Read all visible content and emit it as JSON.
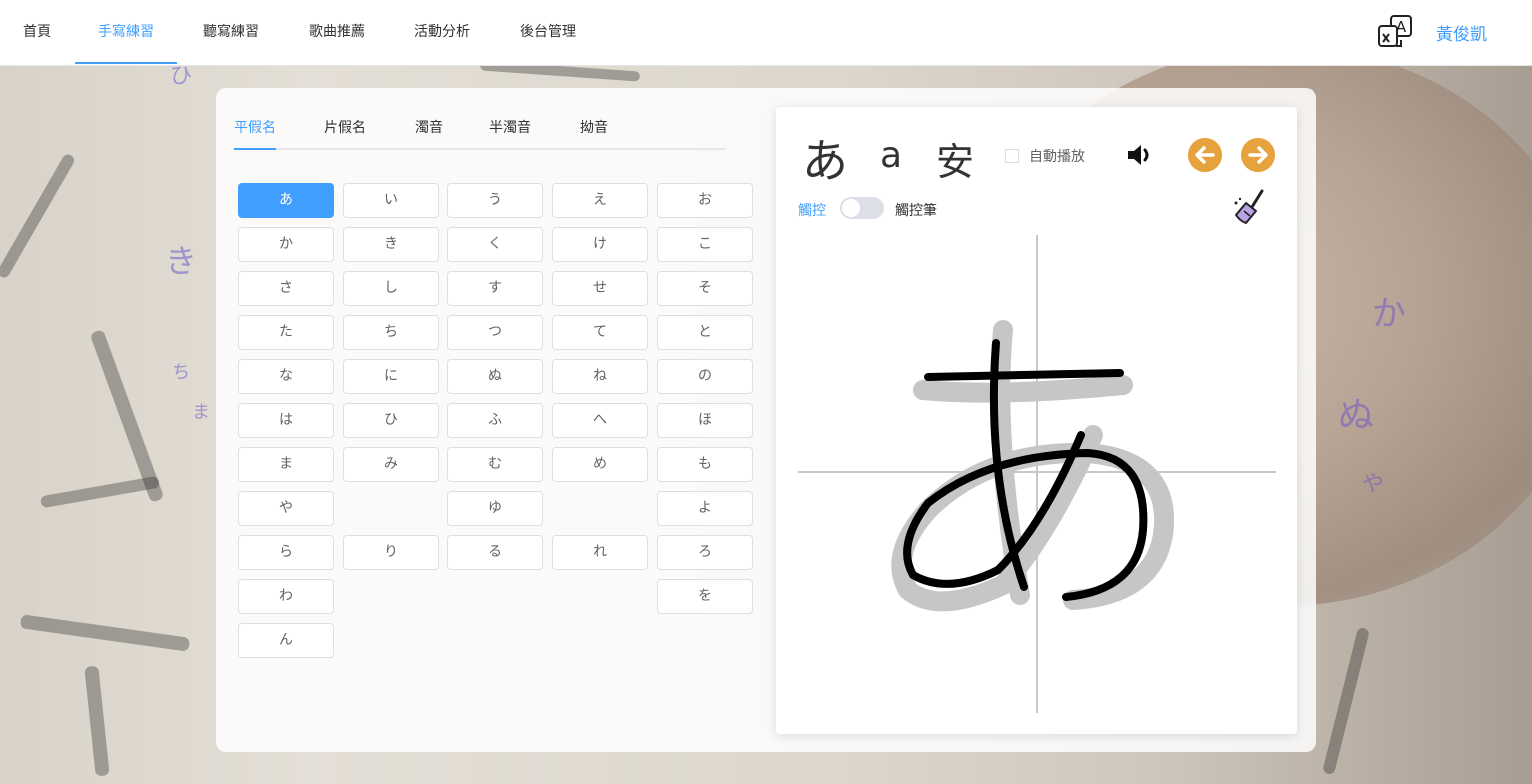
{
  "nav": {
    "items": [
      {
        "label": "首頁"
      },
      {
        "label": "手寫練習"
      },
      {
        "label": "聽寫練習"
      },
      {
        "label": "歌曲推薦"
      },
      {
        "label": "活動分析"
      },
      {
        "label": "後台管理"
      }
    ],
    "active_index": 1,
    "user_name": "黃俊凱",
    "lang_icon": "translate-icon"
  },
  "tabs": {
    "items": [
      {
        "label": "平假名"
      },
      {
        "label": "片假名"
      },
      {
        "label": "濁音"
      },
      {
        "label": "半濁音"
      },
      {
        "label": "拗音"
      }
    ],
    "active_index": 0
  },
  "kana_grid": {
    "rows": [
      [
        "あ",
        "い",
        "う",
        "え",
        "お"
      ],
      [
        "か",
        "き",
        "く",
        "け",
        "こ"
      ],
      [
        "さ",
        "し",
        "す",
        "せ",
        "そ"
      ],
      [
        "た",
        "ち",
        "つ",
        "て",
        "と"
      ],
      [
        "な",
        "に",
        "ぬ",
        "ね",
        "の"
      ],
      [
        "は",
        "ひ",
        "ふ",
        "へ",
        "ほ"
      ],
      [
        "ま",
        "み",
        "む",
        "め",
        "も"
      ],
      [
        "や",
        "",
        "ゆ",
        "",
        "よ"
      ],
      [
        "ら",
        "り",
        "る",
        "れ",
        "ろ"
      ],
      [
        "わ",
        "",
        "",
        "",
        "を"
      ],
      [
        "ん",
        "",
        "",
        "",
        ""
      ]
    ],
    "selected": "あ"
  },
  "practice": {
    "kana": "あ",
    "romaji": "a",
    "kanji": "安",
    "auto_play_label": "自動播放",
    "auto_play_checked": false,
    "speaker_icon": "speaker-icon",
    "prev_icon": "arrow-left-icon",
    "next_icon": "arrow-right-icon",
    "touch_label": "觸控",
    "pen_label": "觸控筆",
    "pen_mode_on": false,
    "clear_icon": "broom-icon"
  },
  "colors": {
    "accent": "#409eff",
    "arrow": "#e6a23c"
  }
}
